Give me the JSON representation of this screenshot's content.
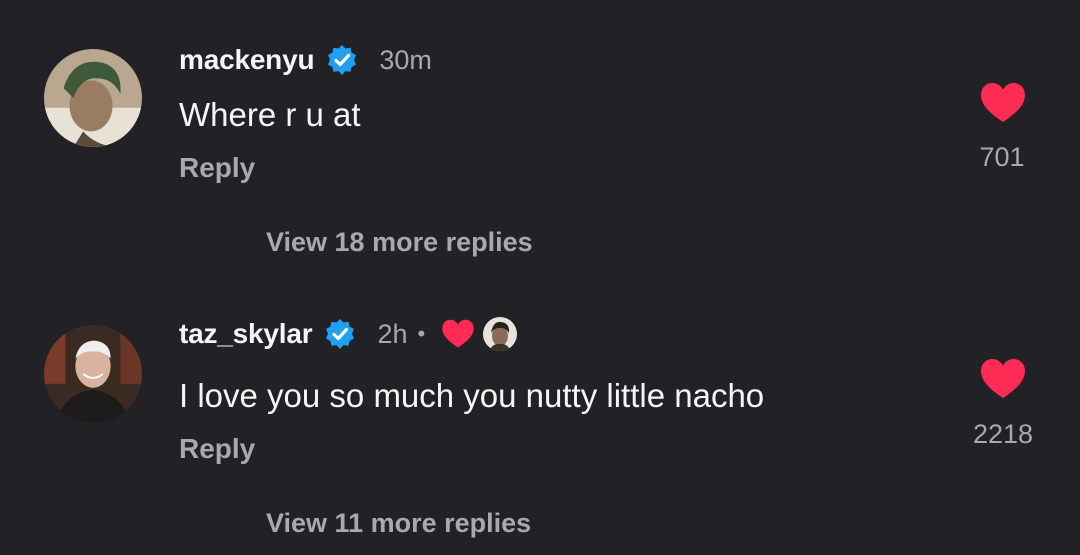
{
  "comments": [
    {
      "username": "mackenyu",
      "time": "30m",
      "text": "Where r u at",
      "reply_label": "Reply",
      "like_count": "701",
      "view_replies": "View 18 more replies",
      "verified": true,
      "liked_by_creator": false
    },
    {
      "username": "taz_skylar",
      "time": "2h",
      "separator": "•",
      "text": "I love you so much you nutty little nacho",
      "reply_label": "Reply",
      "like_count": "2218",
      "view_replies": "View 11 more replies",
      "verified": true,
      "liked_by_creator": true
    }
  ],
  "colors": {
    "background": "#222226",
    "text": "#f5f5f5",
    "muted": "#a8a8ad",
    "heart": "#fe2c55",
    "verified": "#20a0f0"
  },
  "icons": {
    "verified": "verified-badge-icon",
    "like": "heart-icon",
    "creator_like": "creator-heart-icon"
  }
}
